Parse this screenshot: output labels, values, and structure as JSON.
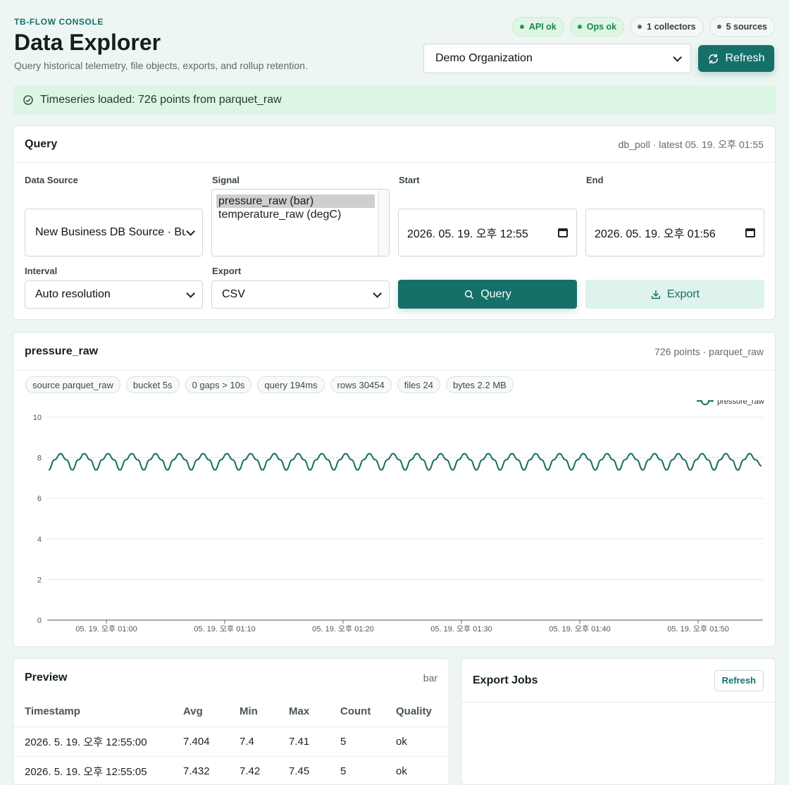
{
  "header": {
    "brand": "TB-FLOW CONSOLE",
    "title": "Data Explorer",
    "subtitle": "Query historical telemetry, file objects, exports, and rollup retention.",
    "status_pills": [
      {
        "label": "API ok",
        "status": "ok"
      },
      {
        "label": "Ops ok",
        "status": "ok"
      },
      {
        "label": "1 collectors",
        "status": "neutral"
      },
      {
        "label": "5 sources",
        "status": "neutral"
      }
    ],
    "org_select": "Demo Organization",
    "refresh_label": "Refresh"
  },
  "banner": {
    "message": "Timeseries loaded: 726 points from parquet_raw"
  },
  "query": {
    "title": "Query",
    "meta": "db_poll · latest 05. 19. 오후 01:55",
    "data_source_label": "Data Source",
    "data_source_value": "New Business DB Source · Business DB",
    "signal_label": "Signal",
    "signals": [
      "pressure_raw (bar)",
      "temperature_raw (degC)"
    ],
    "start_label": "Start",
    "start_value": "2026. 05. 19. 오후 12:55",
    "end_label": "End",
    "end_value": "2026. 05. 19. 오후 01:56",
    "interval_label": "Interval",
    "interval_value": "Auto resolution",
    "export_label": "Export",
    "export_value": "CSV",
    "query_button": "Query",
    "export_button": "Export"
  },
  "chart_panel": {
    "title": "pressure_raw",
    "meta": "726 points · parquet_raw",
    "chips": [
      "source parquet_raw",
      "bucket 5s",
      "0 gaps > 10s",
      "query 194ms",
      "rows 30454",
      "files 24",
      "bytes 2.2 MB"
    ]
  },
  "chart_data": {
    "type": "line",
    "title": "",
    "xlabel": "",
    "ylabel": "",
    "ylim": [
      0,
      10
    ],
    "y_ticks": [
      0,
      2,
      4,
      6,
      8,
      10
    ],
    "x_ticks": [
      "05. 19. 오후 01:00",
      "05. 19. 오후 01:10",
      "05. 19. 오후 01:20",
      "05. 19. 오후 01:30",
      "05. 19. 오후 01:40",
      "05. 19. 오후 01:50"
    ],
    "x_range": [
      "2026-05-19 12:55:00",
      "2026-05-19 13:55:25"
    ],
    "grid": true,
    "legend": "top-right",
    "series": [
      {
        "name": "pressure_raw",
        "color": "#1a6e68",
        "pattern": "periodic oscillation between about 7.4 and 8.2, roughly 30 cycles over the range",
        "values": [
          7.4,
          7.9,
          8.2,
          7.9,
          7.4,
          7.9,
          8.2,
          7.9,
          7.4,
          7.9,
          8.2,
          7.9,
          7.4,
          7.9,
          8.2,
          7.9,
          7.4,
          7.9,
          8.2,
          7.9,
          7.4,
          7.9,
          8.2,
          7.9,
          7.4,
          7.9,
          8.2,
          7.9,
          7.4,
          7.9,
          8.2,
          7.9,
          7.4,
          7.9,
          8.2,
          7.9,
          7.4,
          7.9,
          8.2,
          7.9,
          7.4,
          7.9,
          8.2,
          7.9,
          7.4,
          7.9,
          8.2,
          7.9,
          7.4,
          7.9,
          8.2,
          7.9,
          7.4,
          7.9,
          8.2,
          7.9,
          7.4,
          7.9,
          8.2,
          7.9,
          7.4,
          7.9,
          8.2,
          7.9,
          7.4,
          7.9,
          8.2,
          7.9,
          7.4,
          7.9,
          8.2,
          7.9,
          7.4,
          7.9,
          8.2,
          7.9,
          7.4,
          7.9,
          8.2,
          7.9,
          7.4,
          7.9,
          8.2,
          7.9,
          7.4,
          7.9,
          8.2,
          7.9,
          7.4,
          7.9,
          8.2,
          7.9,
          7.4,
          7.9,
          8.2,
          7.9,
          7.4,
          7.9,
          8.2,
          7.9,
          7.4,
          7.9,
          8.2,
          7.9,
          7.4,
          7.9,
          8.2,
          7.9,
          7.4,
          7.9,
          8.2,
          7.9,
          7.4,
          7.9,
          8.2,
          7.9,
          7.4,
          7.9,
          8.2,
          7.9,
          7.6
        ]
      }
    ]
  },
  "preview": {
    "title": "Preview",
    "unit": "bar",
    "columns": [
      "Timestamp",
      "Avg",
      "Min",
      "Max",
      "Count",
      "Quality"
    ],
    "rows": [
      [
        "2026. 5. 19. 오후 12:55:00",
        "7.404",
        "7.4",
        "7.41",
        "5",
        "ok"
      ],
      [
        "2026. 5. 19. 오후 12:55:05",
        "7.432",
        "7.42",
        "7.45",
        "5",
        "ok"
      ]
    ]
  },
  "export_jobs": {
    "title": "Export Jobs",
    "refresh_label": "Refresh"
  }
}
